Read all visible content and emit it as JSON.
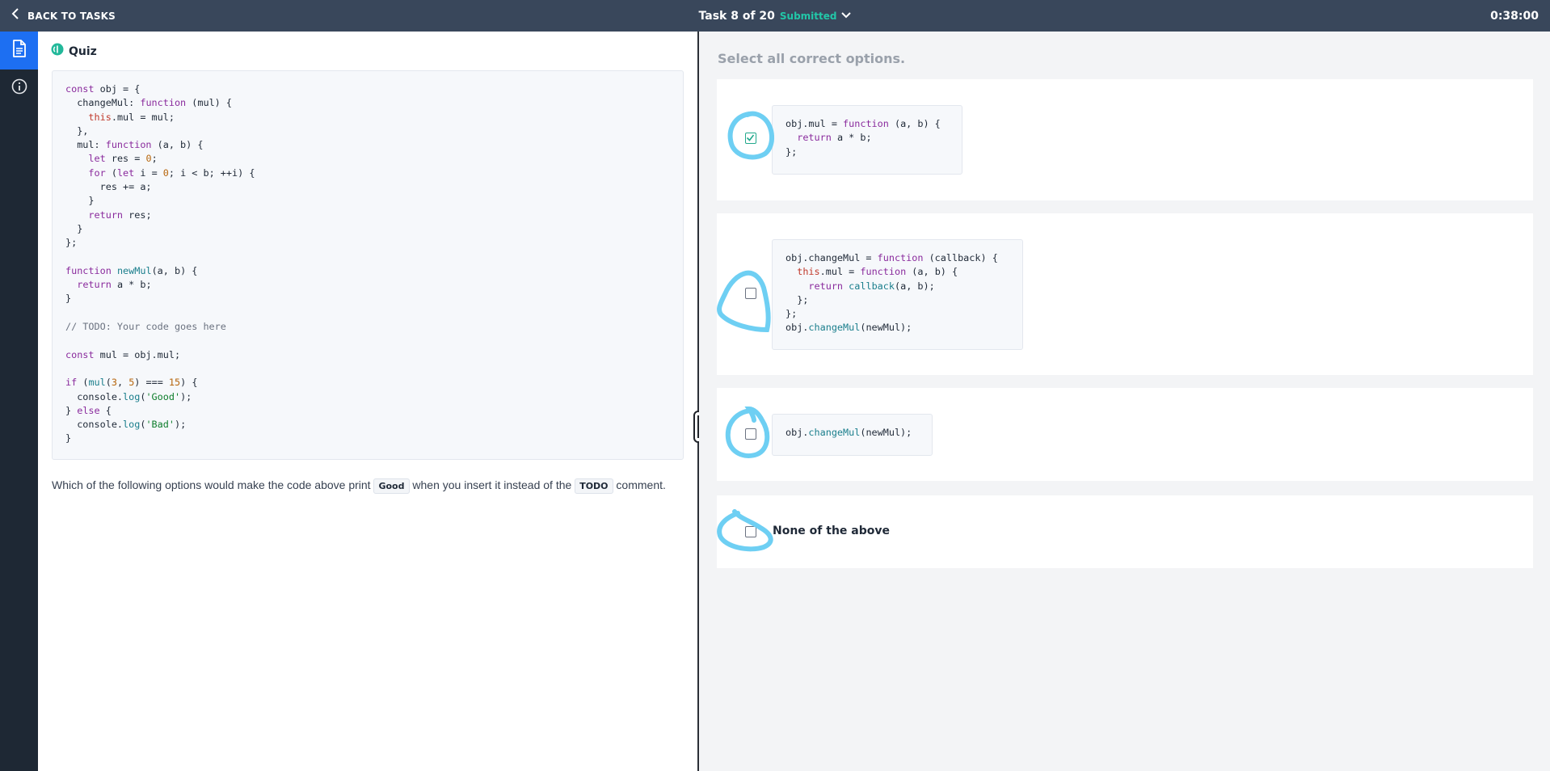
{
  "topbar": {
    "back_label": "BACK TO TASKS",
    "task_label": "Task 8 of 20",
    "status": "Submitted",
    "timer": "0:38:00"
  },
  "rail": {
    "items": [
      {
        "icon": "document-icon",
        "active": true
      },
      {
        "icon": "info-icon",
        "active": false
      }
    ]
  },
  "quiz": {
    "title": "Quiz",
    "code_lines": [
      "const obj = {",
      "  changeMul: function (mul) {",
      "    this.mul = mul;",
      "  },",
      "  mul: function (a, b) {",
      "    let res = 0;",
      "    for (let i = 0; i < b; ++i) {",
      "      res += a;",
      "    }",
      "    return res;",
      "  }",
      "};",
      "",
      "function newMul(a, b) {",
      "  return a * b;",
      "}",
      "",
      "// TODO: Your code goes here",
      "",
      "const mul = obj.mul;",
      "",
      "if (mul(3, 5) === 15) {",
      "  console.log('Good');",
      "} else {",
      "  console.log('Bad');",
      "}"
    ],
    "question_before": "Which of the following options would make the code above print",
    "question_code1": "Good",
    "question_middle": "when you insert it instead of the",
    "question_code2": "TODO",
    "question_after": "comment."
  },
  "answers": {
    "instruction": "Select all correct options.",
    "options": [
      {
        "checked": true,
        "code_lines": [
          "obj.mul = function (a, b) {",
          "  return a * b;",
          "};"
        ]
      },
      {
        "checked": false,
        "code_lines": [
          "obj.changeMul = function (callback) {",
          "  this.mul = function (a, b) {",
          "    return callback(a, b);",
          "  };",
          "};",
          "obj.changeMul(newMul);"
        ]
      },
      {
        "checked": false,
        "code_lines": [
          "obj.changeMul(newMul);"
        ]
      },
      {
        "checked": false,
        "label": "None of the above"
      }
    ]
  },
  "colors": {
    "topbar": "#39475b",
    "rail": "#1e2834",
    "rail_active": "#1d6ff2",
    "status": "#22c7a8",
    "annotation": "#6ecff3"
  }
}
